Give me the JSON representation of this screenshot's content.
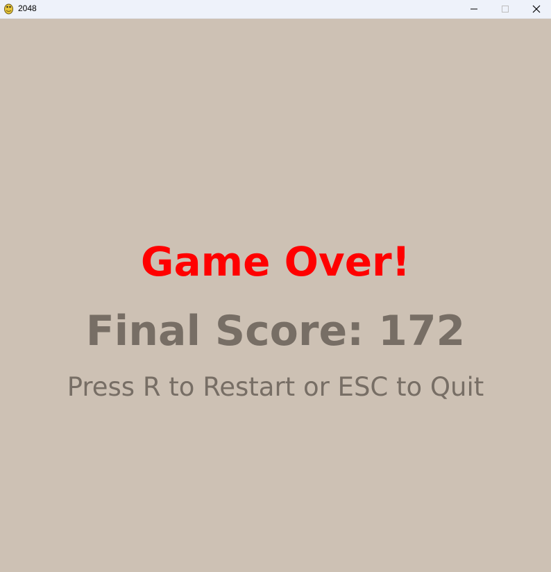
{
  "window": {
    "title": "2048",
    "app_icon": "pygame-snake-icon",
    "controls": {
      "minimize_icon": "minimize-icon",
      "maximize_icon": "maximize-icon",
      "close_icon": "close-icon"
    }
  },
  "game": {
    "game_over_text": "Game Over!",
    "final_score_text": "Final Score: 172",
    "instructions_text": "Press R to Restart or ESC to Quit"
  },
  "colors": {
    "background": "#cdc1b4",
    "game_over": "#ff0000",
    "text": "#776e65",
    "titlebar": "#eef2fa"
  }
}
